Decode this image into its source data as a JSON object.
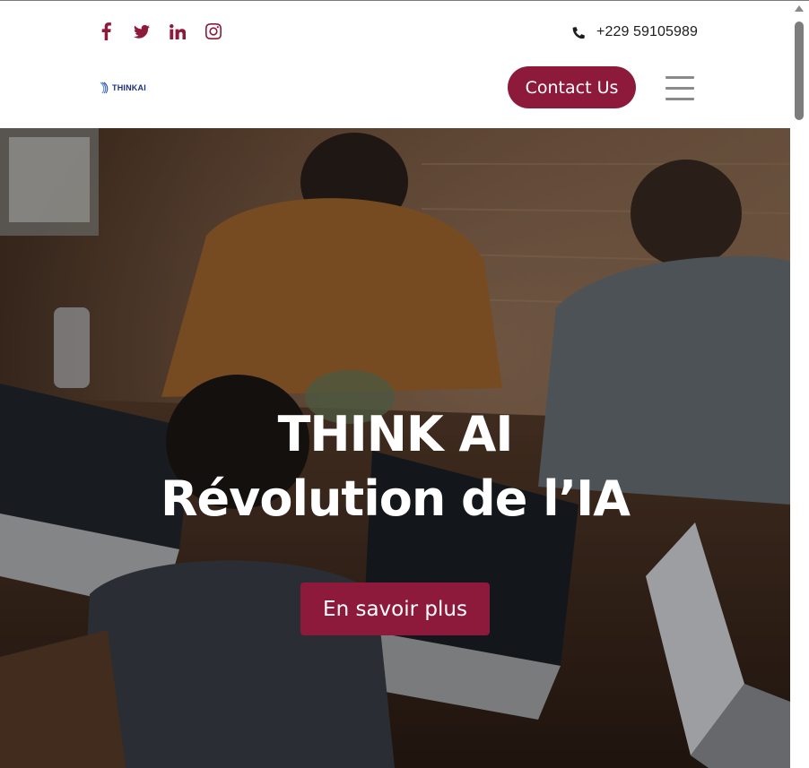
{
  "header": {
    "social_icons": [
      "facebook-icon",
      "twitter-icon",
      "linkedin-icon",
      "instagram-icon"
    ],
    "phone_icon": "phone-icon",
    "phone": "+229 59105989",
    "logo_text": "THINKAI",
    "contact_label": "Contact Us",
    "menu_icon": "hamburger-menu-icon"
  },
  "hero": {
    "title_line1": "THINK AI",
    "title_line2": "Révolution de l’IA",
    "cta_label": "En savoir plus"
  },
  "colors": {
    "brand": "#8e1a3b",
    "logo_blue": "#1c2f7e",
    "text_dark": "#1d1d1d"
  }
}
